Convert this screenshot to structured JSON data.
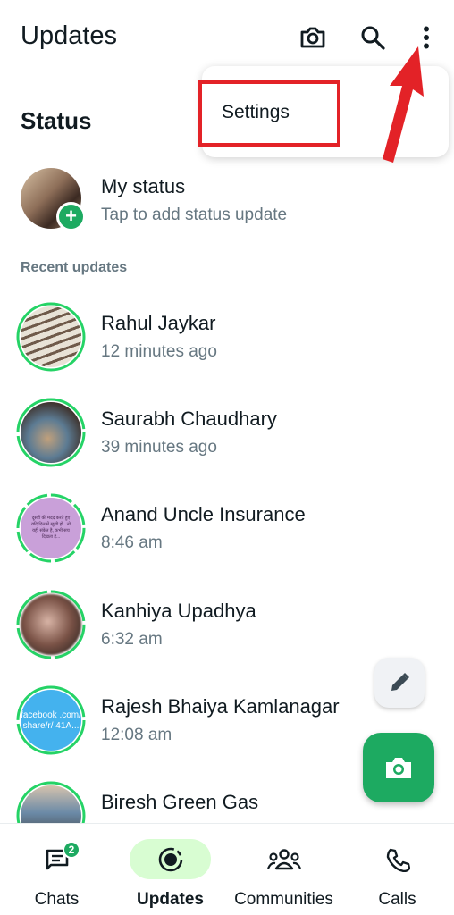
{
  "header": {
    "title": "Updates",
    "icons": [
      "camera-icon",
      "search-icon",
      "more-vertical-icon"
    ]
  },
  "menu": {
    "items": [
      {
        "label": "Settings"
      }
    ]
  },
  "status_section": {
    "title": "Status",
    "my_status": {
      "name": "My status",
      "subtitle": "Tap to add status update"
    },
    "recent_label": "Recent updates",
    "recent": [
      {
        "name": "Rahul Jaykar",
        "time": "12 minutes ago"
      },
      {
        "name": "Saurabh Chaudhary",
        "time": "39 minutes ago"
      },
      {
        "name": "Anand Uncle Insurance",
        "time": "8:46 am",
        "thumb_text": "दूसरों की मदद करते हुए यदि दिल में खुशी हो...तो यही संकेत है, कभी सच दिखता है..."
      },
      {
        "name": "Kanhiya Upadhya",
        "time": "6:32 am"
      },
      {
        "name": "Rajesh Bhaiya Kamlanagar",
        "time": "12:08 am",
        "thumb_text": "facebook .com/ share/r/ 41A..."
      },
      {
        "name": "Biresh Green Gas",
        "time": ""
      }
    ]
  },
  "fab": {
    "edit_icon": "pencil-icon",
    "camera_icon": "camera-icon"
  },
  "bottom_nav": {
    "items": [
      {
        "label": "Chats",
        "badge": "2",
        "icon": "chat-icon"
      },
      {
        "label": "Updates",
        "icon": "updates-icon",
        "active": true
      },
      {
        "label": "Communities",
        "icon": "communities-icon"
      },
      {
        "label": "Calls",
        "icon": "phone-icon"
      }
    ]
  },
  "colors": {
    "accent": "#1daa61",
    "highlight": "#e32227",
    "active_pill": "#d8fdd2",
    "muted_text": "#667781"
  }
}
